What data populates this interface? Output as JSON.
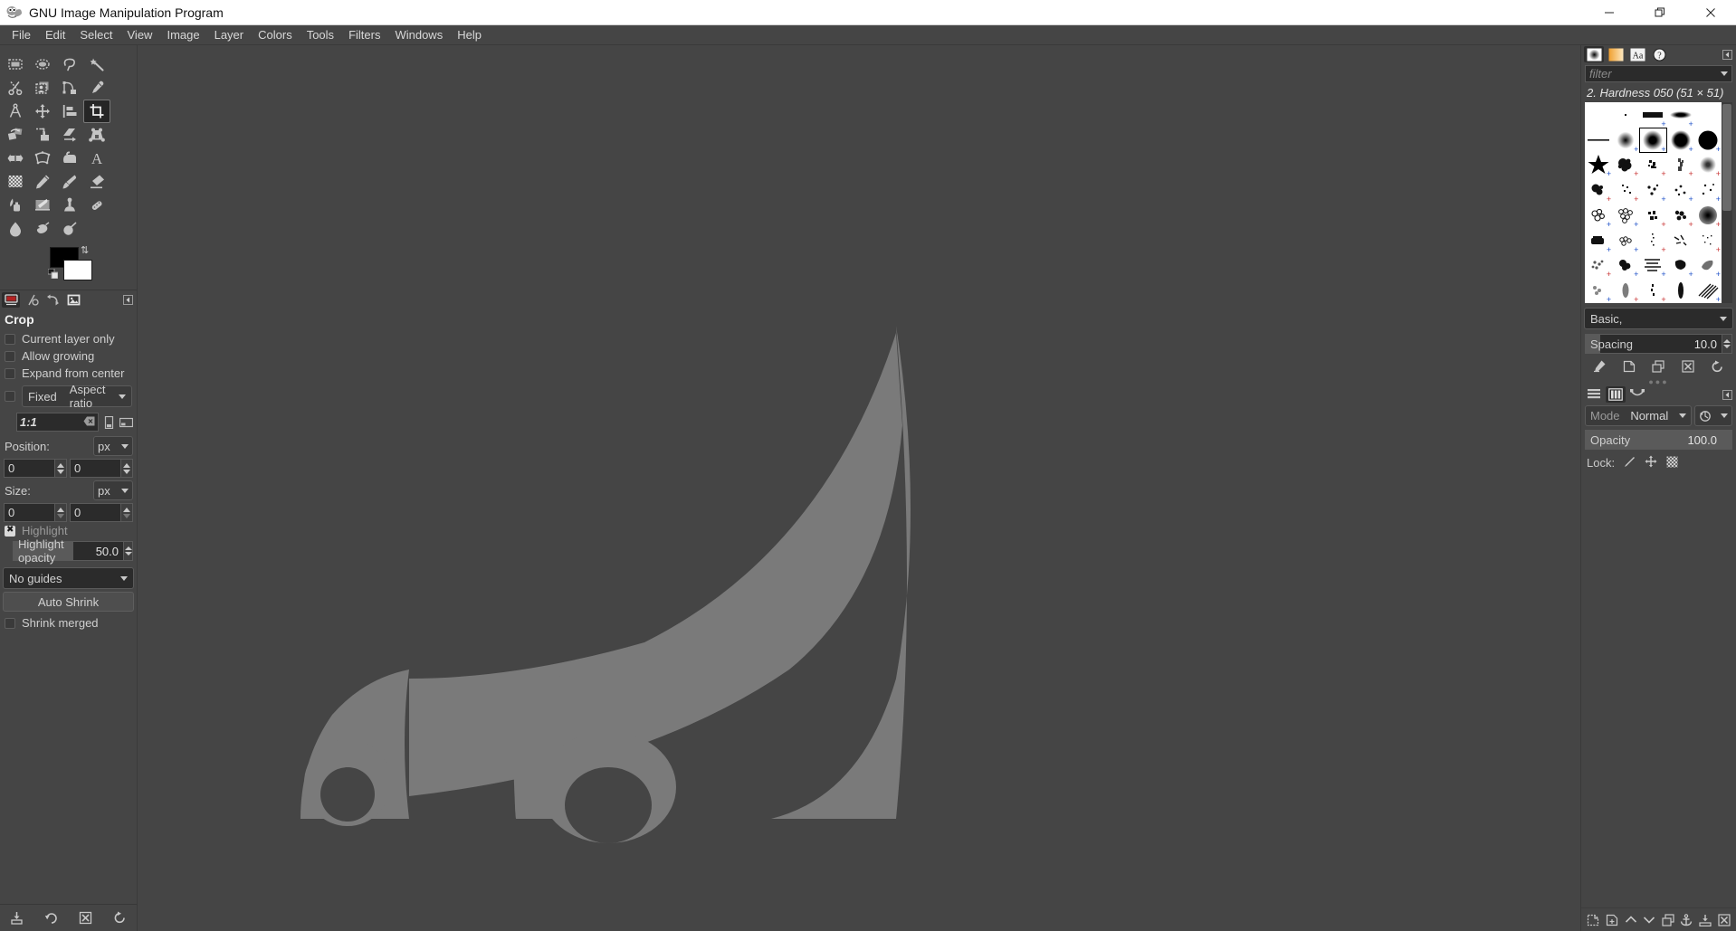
{
  "window": {
    "title": "GNU Image Manipulation Program",
    "app_icon": "wilber-icon",
    "minimize_label": "—",
    "restore_label": "❐",
    "close_label": "✕"
  },
  "menubar": {
    "items": [
      {
        "label": "File",
        "name": "menu-file"
      },
      {
        "label": "Edit",
        "name": "menu-edit"
      },
      {
        "label": "Select",
        "name": "menu-select"
      },
      {
        "label": "View",
        "name": "menu-view"
      },
      {
        "label": "Image",
        "name": "menu-image"
      },
      {
        "label": "Layer",
        "name": "menu-layer"
      },
      {
        "label": "Colors",
        "name": "menu-colors"
      },
      {
        "label": "Tools",
        "name": "menu-tools"
      },
      {
        "label": "Filters",
        "name": "menu-filters"
      },
      {
        "label": "Windows",
        "name": "menu-windows"
      },
      {
        "label": "Help",
        "name": "menu-help"
      }
    ]
  },
  "toolbox": {
    "tools": [
      {
        "name": "rect-select-tool",
        "selected": false
      },
      {
        "name": "ellipse-select-tool",
        "selected": false
      },
      {
        "name": "free-select-tool",
        "selected": false
      },
      {
        "name": "fuzzy-select-tool",
        "selected": false
      },
      {
        "name": "scissors-select-tool",
        "selected": false
      },
      {
        "name": "foreground-select-tool",
        "selected": false
      },
      {
        "name": "paths-tool",
        "selected": false
      },
      {
        "name": "color-picker-tool",
        "selected": false
      },
      {
        "name": "measure-tool",
        "selected": false
      },
      {
        "name": "move-tool",
        "selected": false
      },
      {
        "name": "alignment-tool",
        "selected": false
      },
      {
        "name": "crop-tool",
        "selected": true
      },
      {
        "name": "rotate-tool",
        "selected": false
      },
      {
        "name": "scale-tool",
        "selected": false
      },
      {
        "name": "shear-tool",
        "selected": false
      },
      {
        "name": "perspective-tool",
        "selected": false
      },
      {
        "name": "flip-tool",
        "selected": false
      },
      {
        "name": "cage-transform-tool",
        "selected": false
      },
      {
        "name": "bucket-fill-tool",
        "selected": false
      },
      {
        "name": "text-tool",
        "selected": false
      },
      {
        "name": "gradient-tool",
        "selected": false
      },
      {
        "name": "pencil-tool",
        "selected": false
      },
      {
        "name": "paintbrush-tool",
        "selected": false
      },
      {
        "name": "eraser-tool",
        "selected": false
      },
      {
        "name": "airbrush-tool",
        "selected": false
      },
      {
        "name": "ink-tool",
        "selected": false
      },
      {
        "name": "clone-tool",
        "selected": false
      },
      {
        "name": "heal-tool",
        "selected": false
      },
      {
        "name": "blur-tool",
        "selected": false
      },
      {
        "name": "smudge-tool",
        "selected": false
      },
      {
        "name": "dodge-burn-tool",
        "selected": false
      }
    ],
    "colors": {
      "foreground": "#000000",
      "background": "#ffffff"
    }
  },
  "tool_options": {
    "tabs": [
      {
        "name": "tool-options-tab",
        "active": true
      },
      {
        "name": "device-status-tab",
        "active": false
      },
      {
        "name": "undo-history-tab",
        "active": false
      },
      {
        "name": "images-tab",
        "active": false
      }
    ],
    "title": "Crop",
    "checkboxes": [
      {
        "label": "Current layer only",
        "checked": false,
        "name": "current-layer-only-checkbox"
      },
      {
        "label": "Allow growing",
        "checked": false,
        "name": "allow-growing-checkbox"
      },
      {
        "label": "Expand from center",
        "checked": false,
        "name": "expand-from-center-checkbox"
      }
    ],
    "fixed": {
      "enabled": false,
      "label": "Fixed",
      "value": "Aspect ratio"
    },
    "ratio": {
      "value": "1:1"
    },
    "position": {
      "label": "Position:",
      "unit": "px",
      "x": "0",
      "y": "0"
    },
    "size": {
      "label": "Size:",
      "unit": "px",
      "w": "0",
      "h": "0"
    },
    "highlight": {
      "label": "Highlight",
      "checked": true,
      "opacity_label": "Highlight opacity",
      "opacity_value": "50.0",
      "opacity_percent": 50
    },
    "guides": "No guides",
    "auto_shrink": "Auto Shrink",
    "shrink_merged": {
      "label": "Shrink merged",
      "checked": false
    },
    "footer_icons": [
      {
        "name": "save-tool-preset-icon"
      },
      {
        "name": "restore-tool-preset-icon"
      },
      {
        "name": "delete-tool-preset-icon"
      },
      {
        "name": "reset-tool-options-icon"
      }
    ]
  },
  "brushes_dock": {
    "tabs": [
      {
        "name": "brushes-tab",
        "active": true
      },
      {
        "name": "gradients-tab",
        "active": false
      },
      {
        "name": "fonts-tab",
        "active": false
      },
      {
        "name": "document-history-tab",
        "active": false
      }
    ],
    "filter_placeholder": "filter",
    "selected_brush": "2. Hardness 050 (51 × 51)",
    "tag_filter": "Basic,",
    "spacing": {
      "label": "Spacing",
      "value": "10.0",
      "percent": 10
    },
    "footer_icons": [
      {
        "name": "edit-brush-icon"
      },
      {
        "name": "new-brush-icon"
      },
      {
        "name": "duplicate-brush-icon"
      },
      {
        "name": "delete-brush-icon"
      },
      {
        "name": "refresh-brushes-icon"
      }
    ]
  },
  "layers_dock": {
    "tabs": [
      {
        "name": "layers-tab",
        "active": false
      },
      {
        "name": "channels-tab",
        "active": true
      },
      {
        "name": "paths-tab",
        "active": false
      }
    ],
    "mode": {
      "label": "Mode",
      "value": "Normal"
    },
    "opacity": {
      "label": "Opacity",
      "value": "100.0",
      "percent": 100
    },
    "lock": {
      "label": "Lock:",
      "items": [
        "lock-pixels-icon",
        "lock-position-icon",
        "lock-alpha-icon"
      ]
    },
    "footer_icons": [
      {
        "name": "new-layer-icon"
      },
      {
        "name": "new-layer-group-icon"
      },
      {
        "name": "raise-layer-icon"
      },
      {
        "name": "lower-layer-icon"
      },
      {
        "name": "duplicate-layer-icon"
      },
      {
        "name": "anchor-layer-icon"
      },
      {
        "name": "merge-down-icon"
      },
      {
        "name": "delete-layer-icon"
      }
    ]
  },
  "canvas": {
    "watermark": "wilber-mascot-watermark",
    "background_color": "#454545",
    "watermark_color": "#7a7a7a"
  }
}
